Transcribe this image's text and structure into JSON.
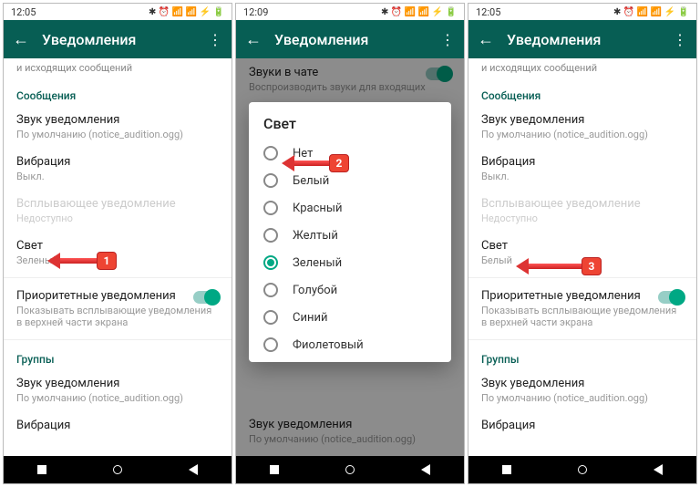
{
  "screens": [
    {
      "statusbar": {
        "time": "12:05",
        "icons": "✱ ⏰ 📶 📶 ⚡ 🔋"
      },
      "appbar": {
        "title": "Уведомления"
      },
      "top_cut": "и исходящих сообщений",
      "sections": {
        "messages": {
          "header": "Сообщения",
          "sound": {
            "title": "Звук уведомления",
            "sub": "По умолчанию (notice_audition.ogg)"
          },
          "vibration": {
            "title": "Вибрация",
            "sub": "Выкл."
          },
          "popup": {
            "title": "Всплывающее уведомление",
            "sub": "Недоступно"
          },
          "light": {
            "title": "Свет",
            "sub": "Зеленый"
          },
          "priority": {
            "title": "Приоритетные уведомления",
            "sub": "Показывать всплывающие уведомления в верхней части экрана"
          }
        },
        "groups": {
          "header": "Группы",
          "sound": {
            "title": "Звук уведомления",
            "sub": "По умолчанию (notice_audition.ogg)"
          },
          "vibration": {
            "title": "Вибрация"
          }
        }
      },
      "callout": "1"
    },
    {
      "statusbar": {
        "time": "12:09",
        "icons": "✱ ⏰ 📶 📶 ⚡ 🔋"
      },
      "appbar": {
        "title": "Уведомления"
      },
      "bg_top": {
        "title": "Звуки в чате",
        "sub": "Воспроизводить звуки для входящих"
      },
      "bg_sound": {
        "title": "Звук уведомления",
        "sub": "По умолчанию (notice_audition.ogg)"
      },
      "dialog": {
        "title": "Свет",
        "options": [
          "Нет",
          "Белый",
          "Красный",
          "Желтый",
          "Зеленый",
          "Голубой",
          "Синий",
          "Фиолетовый"
        ],
        "selected": "Зеленый"
      },
      "callout": "2"
    },
    {
      "statusbar": {
        "time": "12:05",
        "icons": "✱ ⏰ 📶 📶 ⚡ 🔋"
      },
      "appbar": {
        "title": "Уведомления"
      },
      "top_cut": "и исходящих сообщений",
      "sections": {
        "messages": {
          "header": "Сообщения",
          "sound": {
            "title": "Звук уведомления",
            "sub": "По умолчанию (notice_audition.ogg)"
          },
          "vibration": {
            "title": "Вибрация",
            "sub": "Выкл."
          },
          "popup": {
            "title": "Всплывающее уведомление",
            "sub": "Недоступно"
          },
          "light": {
            "title": "Свет",
            "sub": "Белый"
          },
          "priority": {
            "title": "Приоритетные уведомления",
            "sub": "Показывать всплывающие уведомления в верхней части экрана"
          }
        },
        "groups": {
          "header": "Группы",
          "sound": {
            "title": "Звук уведомления",
            "sub": "По умолчанию (notice_audition.ogg)"
          },
          "vibration": {
            "title": "Вибрация"
          }
        }
      },
      "callout": "3"
    }
  ]
}
